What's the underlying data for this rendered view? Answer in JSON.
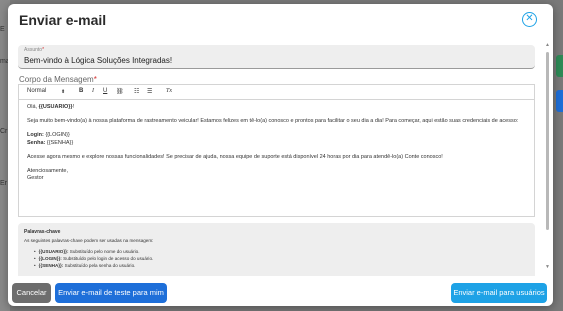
{
  "background": {
    "left_fragments": [
      "E",
      "ma",
      "Cr",
      "Er"
    ]
  },
  "modal": {
    "title": "Enviar e-mail",
    "close_icon": "x-circle-icon",
    "accent_color": "#1ea2e6"
  },
  "subject": {
    "label": "Assunto",
    "required_mark": "*",
    "value": "Bem-vindo à Lógica Soluções Integradas!"
  },
  "body": {
    "label": "Corpo da Mensagem",
    "required_mark": "*",
    "toolbar": {
      "format": "Normal",
      "bold": "B",
      "italic": "I",
      "underline": "U",
      "link": "🔗",
      "ordered_list": "☰",
      "bullet_list": "☰",
      "clear": "Tx"
    },
    "greeting_prefix": "Olá, ",
    "greeting_var": "{{USUARIO}}",
    "greeting_suffix": "!",
    "paragraph1": "Seja muito bem-vindo(a) à nossa plataforma de rastreamento veicular! Estamos felizes em tê-lo(a) conosco e prontos para facilitar o seu dia a dia! Para começar, aqui estão suas credenciais de acesso:",
    "login_label": "Login:",
    "login_var": "{{LOGIN}}",
    "password_label": "Senha:",
    "password_var": "{{SENHA}}",
    "paragraph2": "Acesse agora mesmo e explore nossas funcionalidades! Se precisar de ajuda, nossa equipe de suporte está disponível 24 horas por dia para atendê-lo(a) Conte conosco!",
    "closing": "Atenciosamente,",
    "signature": "Gestor"
  },
  "keywords": {
    "title": "Palavras-chave",
    "description": "As seguintes palavras-chave podem ser usadas na mensagem:",
    "items": [
      {
        "key": "{{USUARIO}}:",
        "desc": "Substituído pelo nome do usuário."
      },
      {
        "key": "{{LOGIN}}:",
        "desc": "Substituído pelo login de acesso do usuário."
      },
      {
        "key": "{{SENHA}}:",
        "desc": "Substituído pela senha do usuário."
      }
    ]
  },
  "footer": {
    "cancel": "Cancelar",
    "test_email": "Enviar e-mail de teste para mim",
    "send_users": "Enviar e-mail para usuários"
  }
}
